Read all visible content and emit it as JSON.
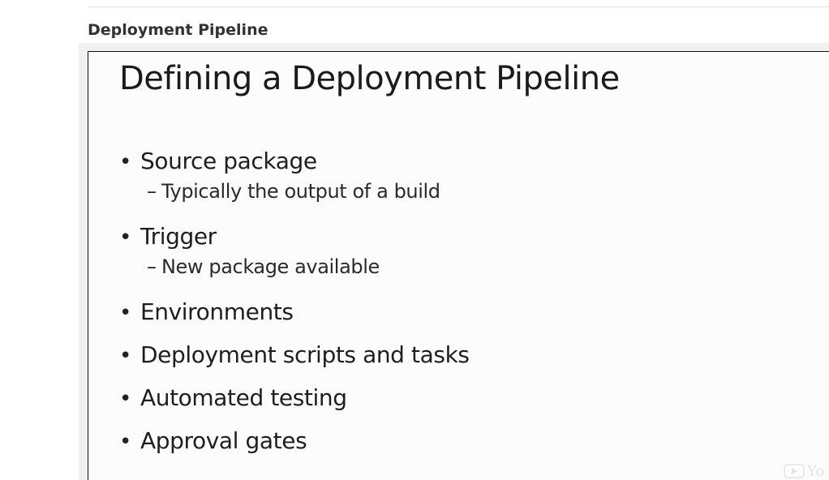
{
  "section": {
    "heading": "Deployment Pipeline"
  },
  "slide": {
    "title": "Defining a Deployment Pipeline",
    "bullet_symbol": "•",
    "sub_symbol": "–",
    "bullets": [
      {
        "text": "Source package",
        "sub": "Typically the output of a build"
      },
      {
        "text": "Trigger",
        "sub": "New package available"
      },
      {
        "text": "Environments"
      },
      {
        "text": "Deployment scripts and tasks"
      },
      {
        "text": "Automated testing"
      },
      {
        "text": "Approval gates"
      }
    ]
  },
  "watermark": {
    "icon": "play-logo-icon",
    "text": "Yo"
  }
}
